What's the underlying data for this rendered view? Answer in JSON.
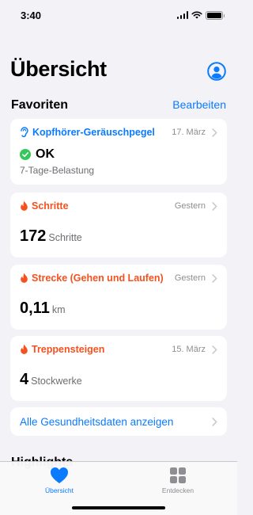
{
  "status": {
    "time": "3:40"
  },
  "header": {
    "title": "Übersicht"
  },
  "favorites": {
    "title": "Favoriten",
    "edit_label": "Bearbeiten",
    "cards": [
      {
        "title": "Kopfhörer-Geräuschpegel",
        "date": "17. März",
        "status": "OK",
        "subtitle": "7-Tage-Belastung",
        "icon": "ear-icon",
        "color": "#0a7aff"
      },
      {
        "title": "Schritte",
        "date": "Gestern",
        "value": "172",
        "unit": "Schritte",
        "icon": "flame-icon",
        "color": "#f4511e"
      },
      {
        "title": "Strecke (Gehen und Laufen)",
        "date": "Gestern",
        "value": "0,11",
        "unit": "km",
        "icon": "flame-icon",
        "color": "#f4511e"
      },
      {
        "title": "Treppensteigen",
        "date": "15. März",
        "value": "4",
        "unit": "Stockwerke",
        "icon": "flame-icon",
        "color": "#f4511e"
      }
    ],
    "all_data_label": "Alle Gesundheitsdaten anzeigen"
  },
  "highlights": {
    "title": "Highlights"
  },
  "tabs": [
    {
      "label": "Übersicht",
      "icon": "heart-icon",
      "active": true
    },
    {
      "label": "Entdecken",
      "icon": "grid-icon",
      "active": false
    }
  ],
  "colors": {
    "accent": "#0a7aff",
    "activity": "#f4511e",
    "ok": "#34c759"
  }
}
